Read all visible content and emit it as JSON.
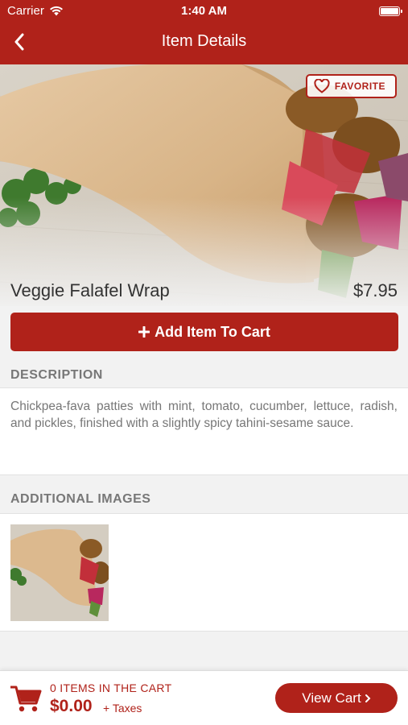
{
  "status_bar": {
    "carrier": "Carrier",
    "time": "1:40 AM"
  },
  "nav": {
    "title": "Item Details",
    "back_icon": "chevron-left-icon"
  },
  "item": {
    "name": "Veggie Falafel Wrap",
    "price": "$7.95",
    "favorite_label": "FAVORITE"
  },
  "actions": {
    "add_to_cart_label": "Add Item To Cart"
  },
  "description": {
    "header": "DESCRIPTION",
    "text": "Chickpea-fava patties with mint, tomato, cucumber, lettuce, radish, and pickles, finished with a slightly spicy tahini-sesame sauce."
  },
  "additional_images": {
    "header": "ADDITIONAL IMAGES"
  },
  "cart": {
    "count_text": "0 ITEMS IN THE CART",
    "total": "$0.00",
    "taxes": "+ Taxes",
    "view_cart_label": "View Cart"
  },
  "colors": {
    "brand": "#b0221a",
    "background": "#f2f2f2"
  }
}
